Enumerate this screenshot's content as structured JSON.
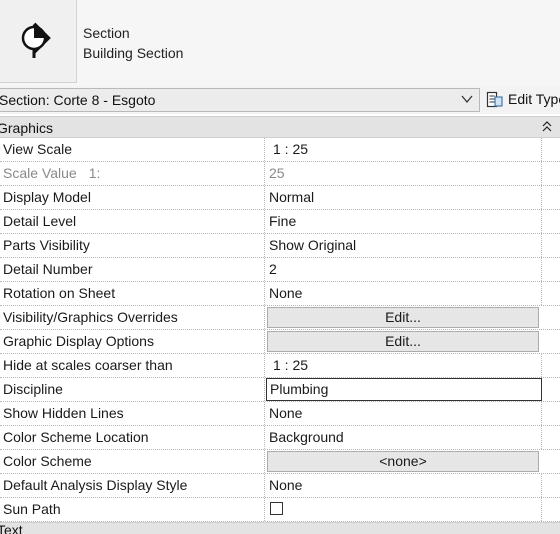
{
  "type_selector": {
    "family": "Section",
    "type": "Building Section",
    "icon": "section-head-icon"
  },
  "instance_selector": {
    "value": "Section: Corte 8 - Esgoto",
    "edit_type_label": "Edit Type"
  },
  "groups": [
    {
      "label": "Graphics",
      "collapsed": false,
      "properties": [
        {
          "name": "View Scale",
          "value": "1 : 25",
          "kind": "text"
        },
        {
          "name": "Scale Value",
          "name_suffix": "1:",
          "value": "25",
          "kind": "text",
          "disabled": true
        },
        {
          "name": "Display Model",
          "value": "Normal",
          "kind": "text"
        },
        {
          "name": "Detail Level",
          "value": "Fine",
          "kind": "text"
        },
        {
          "name": "Parts Visibility",
          "value": "Show Original",
          "kind": "text"
        },
        {
          "name": "Detail Number",
          "value": "2",
          "kind": "text"
        },
        {
          "name": "Rotation on Sheet",
          "value": "None",
          "kind": "text"
        },
        {
          "name": "Visibility/Graphics Overrides",
          "value": "Edit...",
          "kind": "button"
        },
        {
          "name": "Graphic Display Options",
          "value": "Edit...",
          "kind": "button"
        },
        {
          "name": "Hide at scales coarser than",
          "value": "1 : 25",
          "kind": "text"
        },
        {
          "name": "Discipline",
          "value": "Plumbing",
          "kind": "framed"
        },
        {
          "name": "Show Hidden Lines",
          "value": "None",
          "kind": "text"
        },
        {
          "name": "Color Scheme Location",
          "value": "Background",
          "kind": "text"
        },
        {
          "name": "Color Scheme",
          "value": "<none>",
          "kind": "button"
        },
        {
          "name": "Default Analysis Display Style",
          "value": "None",
          "kind": "text"
        },
        {
          "name": "Sun Path",
          "value": false,
          "kind": "checkbox"
        }
      ]
    },
    {
      "label": "Text",
      "collapsed": false,
      "properties": []
    }
  ],
  "colors": {
    "header_bg": "#f6f6f6",
    "group_bg": "#e3e3e3",
    "button_bg": "#e6e6e6",
    "disabled_text": "#8a8a8a"
  }
}
